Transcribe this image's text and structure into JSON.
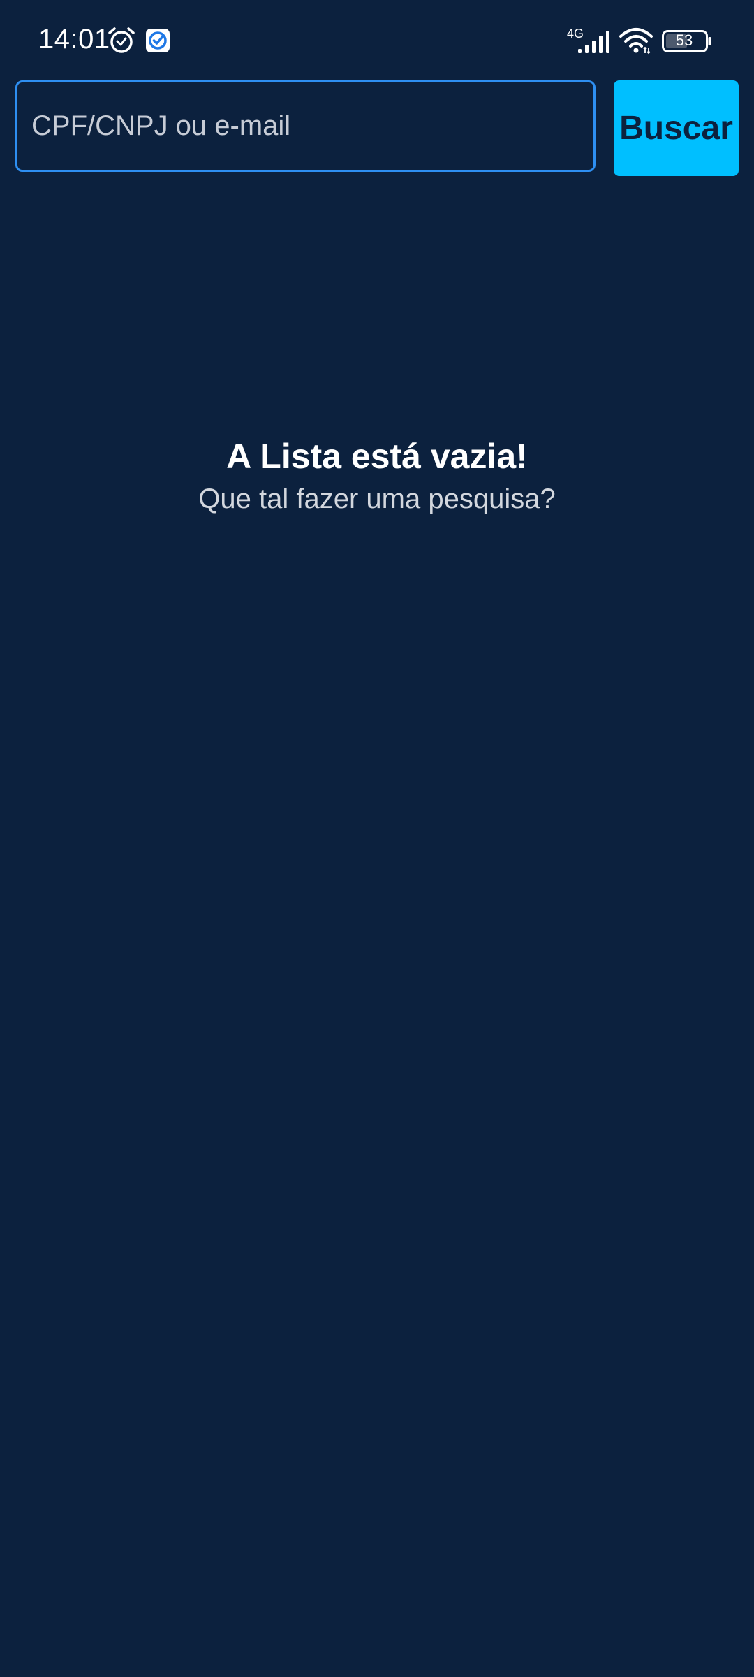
{
  "status_bar": {
    "time": "14:01",
    "network": "4G",
    "battery": "53"
  },
  "search": {
    "placeholder": "CPF/CNPJ ou e-mail",
    "value": "",
    "button_label": "Buscar"
  },
  "empty_state": {
    "title": "A Lista está vazia!",
    "subtitle": "Que tal fazer uma pesquisa?"
  },
  "icons": {
    "alarm": "alarm-icon",
    "app_notification": "check-badge-icon",
    "signal": "cellular-signal-icon",
    "wifi": "wifi-icon",
    "battery": "battery-icon"
  },
  "colors": {
    "background": "#0c213e",
    "accent": "#00bfff",
    "input_border": "#2e8ff2",
    "text_primary": "#ffffff",
    "text_secondary": "#d3d7de"
  }
}
